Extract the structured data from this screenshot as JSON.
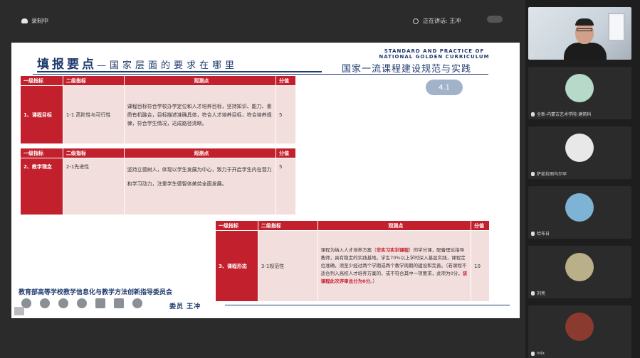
{
  "topbar": {
    "recording_label": "录制中",
    "speaking_label": "正在讲话: 王冲"
  },
  "slide": {
    "title_main": "填报要点",
    "title_sub": "—国家层面的要求在哪里",
    "en_title_line1": "STANDARD AND PRACTICE OF",
    "en_title_line2": "NATIONAL GOLDEN CURRICULUM",
    "cn_title": "国家一流课程建设规范与实践",
    "pager": "4.1",
    "headers": [
      "一级指标",
      "二级指标",
      "观测点",
      "分值"
    ],
    "rows": [
      {
        "level1": "1、课程目标",
        "level2": "1-1 高阶性与可行性",
        "observation": "课程目标符合学校办学定位和人才培养目标，坚持知识、能力、素质有机融合，目标描述准确具体，符合人才培养目标，符合培养规律，符合学生情况，达成路径清晰。",
        "score": "5"
      },
      {
        "level1": "2、教学理念",
        "level2": "2-1先进性",
        "observation": "坚持立德树人，体现以学生发展为中心，致力于开启学生内在潜力和学习动力，注重学生德智体美劳全面发展。",
        "score": "5"
      },
      {
        "level1": "3、课程形态",
        "level2": "3-1规范性",
        "observation_a": "课程为纳入人才培养方案（",
        "observation_hl1": "非实习实训课程",
        "observation_b": "）的学分课，配备理论指导教师，具有稳定的实践基地，学生70%以上学时深入基层实践，课程定位准确，须至少经过两个学期或两个教学周期的建设和完善。（若课程不适合列入高校人才培养方案的，或不符合其中一项要求，此项为0分，",
        "observation_hl2": "该课程此次评审总分为0分",
        "observation_c": "。）",
        "score": "10"
      }
    ],
    "footer_org": "教育部高等学校教学信息化与教学方法创新指导委员会",
    "footer_name": "委员  王冲"
  },
  "participants": [
    {
      "name": "王冲",
      "type": "video"
    },
    {
      "name": "全新-内蒙古艺术学院-建筑科",
      "type": "avatar",
      "color": "#b7d9c9"
    },
    {
      "name": "萨茹拉图乌尔罕",
      "type": "avatar",
      "color": "#e8e8e8"
    },
    {
      "name": "哈布日",
      "type": "avatar",
      "color": "#7fb3d5"
    },
    {
      "name": "刘亮",
      "type": "avatar",
      "color": "#b9b08a"
    },
    {
      "name": "mix",
      "type": "avatar",
      "color": "#8b3a2f"
    }
  ]
}
